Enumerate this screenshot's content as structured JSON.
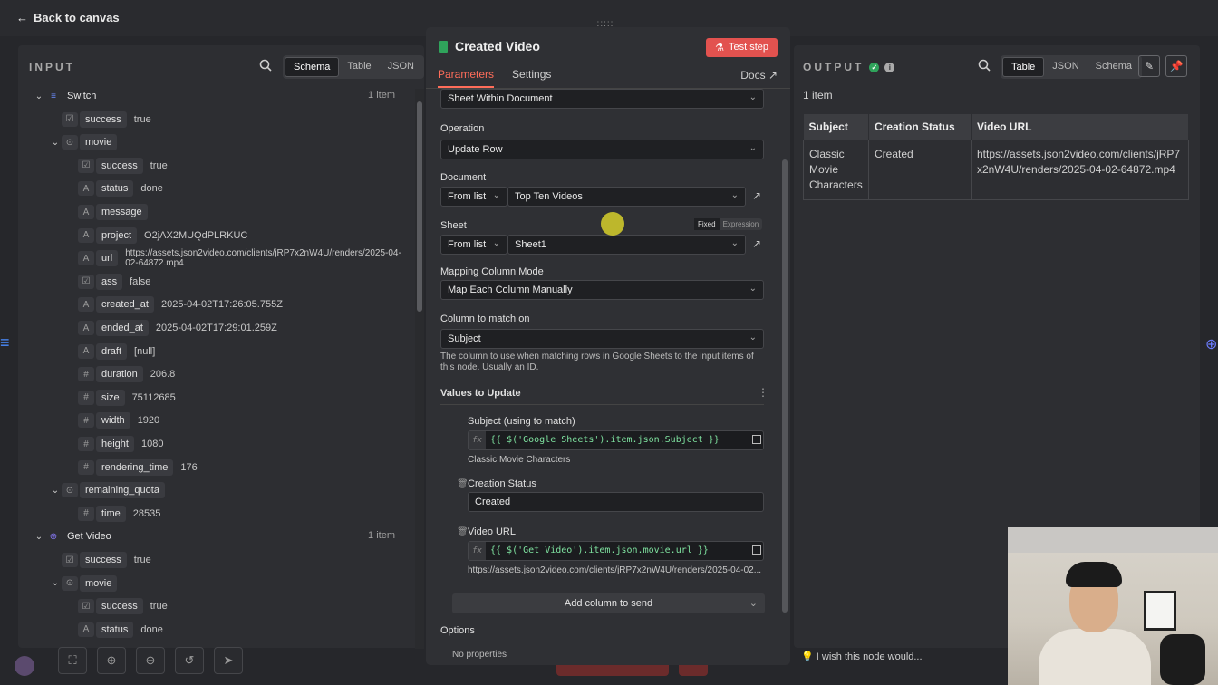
{
  "back_label": "Back to canvas",
  "input": {
    "title": "INPUT",
    "tabs": [
      "Schema",
      "Table",
      "JSON"
    ],
    "tree": [
      {
        "depth": 0,
        "chev": "v",
        "icon": "node",
        "key": "Switch",
        "count": "1 item"
      },
      {
        "depth": 1,
        "icon": "bool",
        "key": "success",
        "val": "true"
      },
      {
        "depth": 1,
        "chev": "v",
        "icon": "obj",
        "key": "movie"
      },
      {
        "depth": 2,
        "icon": "bool",
        "key": "success",
        "val": "true"
      },
      {
        "depth": 2,
        "icon": "A",
        "key": "status",
        "val": "done"
      },
      {
        "depth": 2,
        "icon": "A",
        "key": "message",
        "val": ""
      },
      {
        "depth": 2,
        "icon": "A",
        "key": "project",
        "val": "O2jAX2MUQdPLRKUC"
      },
      {
        "depth": 2,
        "icon": "A",
        "key": "url",
        "val": "https://assets.json2video.com/clients/jRP7x2nW4U/renders/2025-04-02-64872.mp4"
      },
      {
        "depth": 2,
        "icon": "bool",
        "key": "ass",
        "val": "false"
      },
      {
        "depth": 2,
        "icon": "A",
        "key": "created_at",
        "val": "2025-04-02T17:26:05.755Z"
      },
      {
        "depth": 2,
        "icon": "A",
        "key": "ended_at",
        "val": "2025-04-02T17:29:01.259Z"
      },
      {
        "depth": 2,
        "icon": "A",
        "key": "draft",
        "val": "[null]"
      },
      {
        "depth": 2,
        "icon": "#",
        "key": "duration",
        "val": "206.8"
      },
      {
        "depth": 2,
        "icon": "#",
        "key": "size",
        "val": "75112685"
      },
      {
        "depth": 2,
        "icon": "#",
        "key": "width",
        "val": "1920"
      },
      {
        "depth": 2,
        "icon": "#",
        "key": "height",
        "val": "1080"
      },
      {
        "depth": 2,
        "icon": "#",
        "key": "rendering_time",
        "val": "176"
      },
      {
        "depth": 1,
        "chev": "v",
        "icon": "obj",
        "key": "remaining_quota"
      },
      {
        "depth": 2,
        "icon": "#",
        "key": "time",
        "val": "28535"
      },
      {
        "depth": 0,
        "chev": "v",
        "icon": "globe",
        "key": "Get Video",
        "count": "1 item"
      },
      {
        "depth": 1,
        "icon": "bool",
        "key": "success",
        "val": "true"
      },
      {
        "depth": 1,
        "chev": "v",
        "icon": "obj",
        "key": "movie"
      },
      {
        "depth": 2,
        "icon": "bool",
        "key": "success",
        "val": "true"
      },
      {
        "depth": 2,
        "icon": "A",
        "key": "status",
        "val": "done"
      }
    ]
  },
  "node": {
    "title": "Created Video",
    "test_step": "Test step",
    "tabs": [
      "Parameters",
      "Settings"
    ],
    "docs": "Docs",
    "sheet_within": "Sheet Within Document",
    "operation_label": "Operation",
    "operation_value": "Update Row",
    "document_label": "Document",
    "document_mode": "From list",
    "document_value": "Top Ten Videos",
    "sheet_label": "Sheet",
    "sheet_mode": "From list",
    "sheet_value": "Sheet1",
    "toggle_fixed": "Fixed",
    "toggle_expression": "Expression",
    "mapping_label": "Mapping Column Mode",
    "mapping_value": "Map Each Column Manually",
    "match_label": "Column to match on",
    "match_value": "Subject",
    "match_help": "The column to use when matching rows in Google Sheets to the input items of this node. Usually an ID.",
    "values_label": "Values to Update",
    "subject_label": "Subject (using to match)",
    "subject_expr": "{{ $('Google Sheets').item.json.Subject }}",
    "subject_result": "Classic Movie Characters",
    "creation_label": "Creation Status",
    "creation_value": "Created",
    "video_label": "Video URL",
    "video_expr": "{{ $('Get Video').item.json.movie.url }}",
    "video_result": "https://assets.json2video.com/clients/jRP7x2nW4U/renders/2025-04-02...",
    "add_column": "Add column to send",
    "options_label": "Options",
    "no_properties": "No properties"
  },
  "output": {
    "title": "OUTPUT",
    "tabs": [
      "Table",
      "JSON",
      "Schema"
    ],
    "items": "1 item",
    "columns": [
      "Subject",
      "Creation Status",
      "Video URL"
    ],
    "row": [
      "Classic Movie Characters",
      "Created",
      "https://assets.json2video.com/clients/jRP7x2nW4U/renders/2025-04-02-64872.mp4"
    ],
    "wish": "I wish this node would..."
  },
  "colors": {
    "accent": "#ff6d5a",
    "test_button": "#e2524f",
    "success": "#2fa35b"
  }
}
